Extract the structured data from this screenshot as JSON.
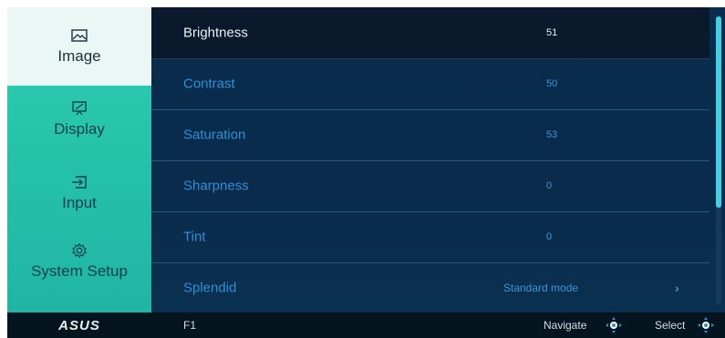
{
  "sidebar": {
    "items": [
      {
        "label": "Image",
        "icon": "image-icon",
        "active": true
      },
      {
        "label": "Display",
        "icon": "display-icon"
      },
      {
        "label": "Input",
        "icon": "input-icon"
      },
      {
        "label": "System Setup",
        "icon": "gear-icon"
      }
    ],
    "logo": "ASUS"
  },
  "settings": [
    {
      "name": "Brightness",
      "value": "51"
    },
    {
      "name": "Contrast",
      "value": "50"
    },
    {
      "name": "Saturation",
      "value": "53"
    },
    {
      "name": "Sharpness",
      "value": "0"
    },
    {
      "name": "Tint",
      "value": "0"
    },
    {
      "name": "Splendid",
      "value": "Standard mode",
      "chevron": "›"
    }
  ],
  "footer": {
    "f1": "F1",
    "navigate": "Navigate",
    "select": "Select"
  },
  "colors": {
    "sidebar_teal": "#25c2aa",
    "panel_blue": "#0b2d4d",
    "accent_text": "#2e8fd6",
    "scroll_thumb": "#3fd1e6"
  }
}
